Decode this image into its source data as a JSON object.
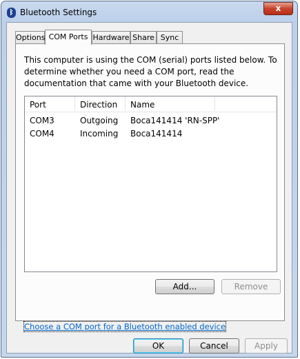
{
  "window": {
    "title": "Bluetooth Settings",
    "close_glyph": "x"
  },
  "tabs": [
    {
      "label": "Options"
    },
    {
      "label": "COM Ports",
      "active": true
    },
    {
      "label": "Hardware"
    },
    {
      "label": "Share"
    },
    {
      "label": "Sync"
    }
  ],
  "description": "This computer is using the COM (serial) ports listed below. To determine whether you need a COM port, read the documentation that came with your Bluetooth device.",
  "list": {
    "columns": [
      "Port",
      "Direction",
      "Name"
    ],
    "rows": [
      [
        "COM3",
        "Outgoing",
        "Boca141414 'RN-SPP'"
      ],
      [
        "COM4",
        "Incoming",
        "Boca141414"
      ]
    ]
  },
  "buttons": {
    "add": "Add...",
    "remove": "Remove",
    "ok": "OK",
    "cancel": "Cancel",
    "apply": "Apply"
  },
  "link_text": "Choose a COM port for a Bluetooth enabled device",
  "colors": {
    "title_bar": "#c9d9ee",
    "close_button": "#c7432b",
    "link": "#0066cc"
  }
}
